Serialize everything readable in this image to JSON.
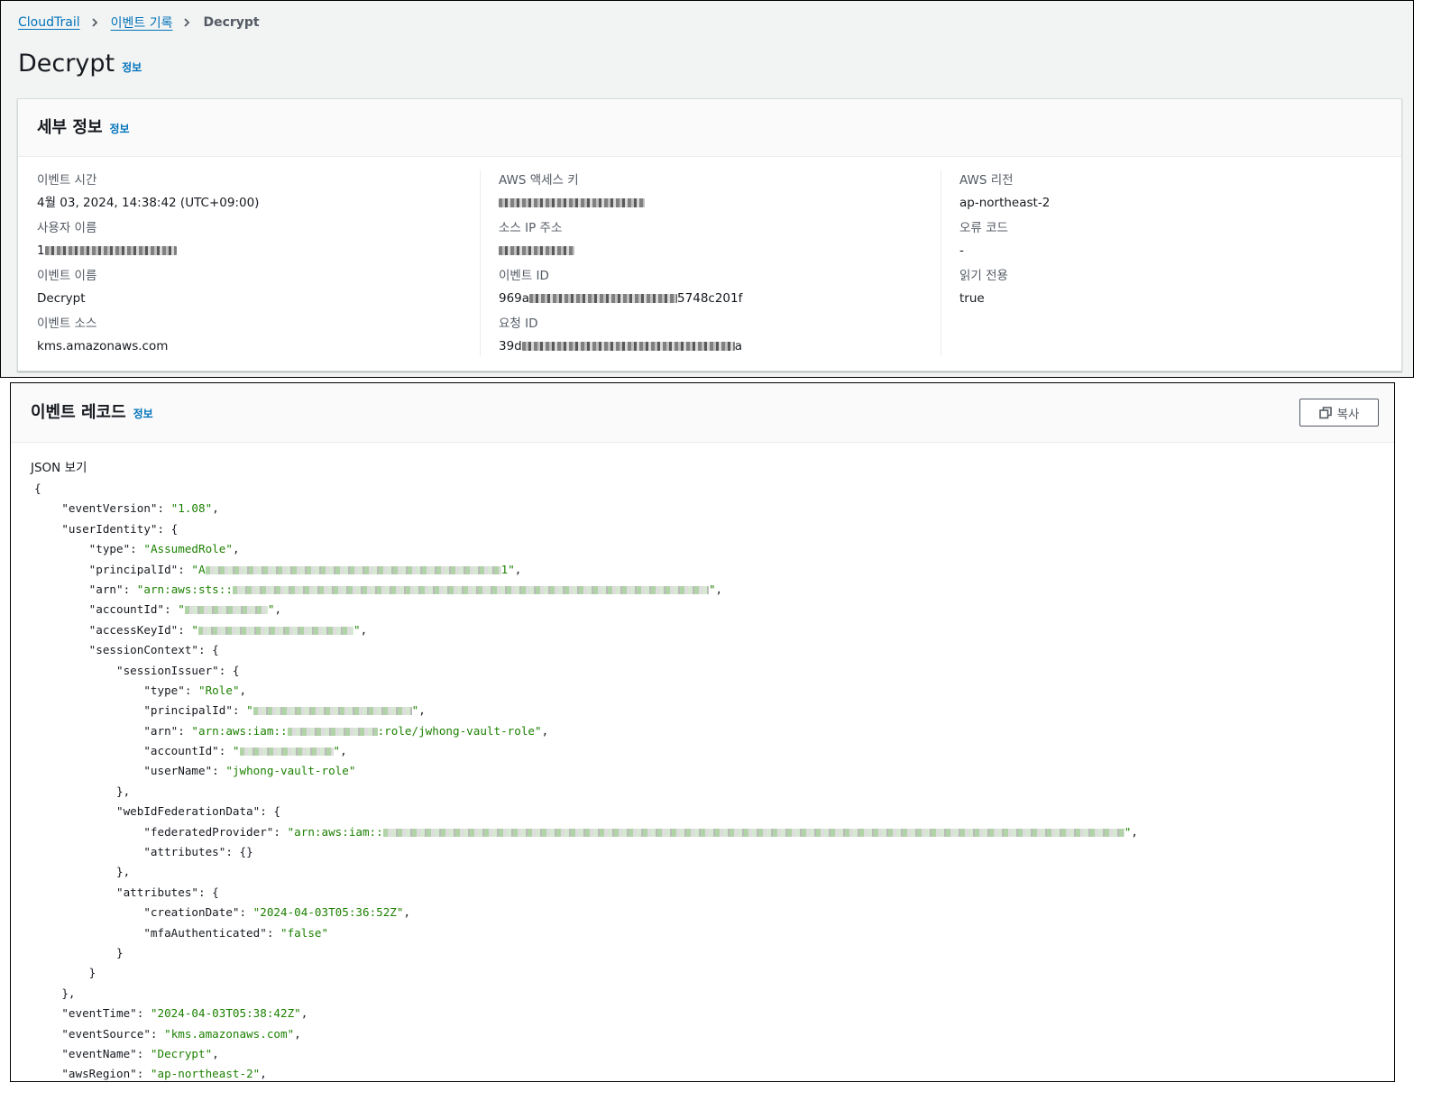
{
  "breadcrumb": {
    "items": [
      "CloudTrail",
      "이벤트 기록"
    ],
    "current": "Decrypt"
  },
  "page": {
    "title": "Decrypt",
    "info": "정보"
  },
  "details": {
    "title": "세부 정보",
    "info": "정보",
    "col1": [
      {
        "label": "이벤트 시간",
        "value": "4월 03, 2024, 14:38:42 (UTC+09:00)"
      },
      {
        "label": "사용자 이름",
        "value": "1"
      },
      {
        "label": "이벤트 이름",
        "value": "Decrypt"
      },
      {
        "label": "이벤트 소스",
        "value": "kms.amazonaws.com"
      }
    ],
    "col2": [
      {
        "label": "AWS 액세스 키",
        "value": ""
      },
      {
        "label": "소스 IP 주소",
        "value": ""
      },
      {
        "label": "이벤트 ID",
        "prefix": "969a",
        "suffix": "5748c201f"
      },
      {
        "label": "요청 ID",
        "prefix": "39d",
        "suffix": "a"
      }
    ],
    "col3": [
      {
        "label": "AWS 리전",
        "value": "ap-northeast-2"
      },
      {
        "label": "오류 코드",
        "value": "-"
      },
      {
        "label": "읽기 전용",
        "value": "true"
      }
    ]
  },
  "record": {
    "title": "이벤트 레코드",
    "info": "정보",
    "copy_label": "복사",
    "json_label": "JSON 보기",
    "json": {
      "eventVersion": "1.08",
      "type": "AssumedRole",
      "principalId_prefix": "A",
      "principalId_suffix": "1",
      "arn_prefix": "arn:aws:sts::",
      "issuer_type": "Role",
      "issuer_arn_prefix": "arn:aws:iam::",
      "issuer_arn_suffix": ":role/jwhong-vault-role",
      "userName": "jwhong-vault-role",
      "federatedProvider_prefix": "arn:aws:iam::",
      "creationDate": "2024-04-03T05:36:52Z",
      "mfaAuthenticated": "false",
      "eventTime": "2024-04-03T05:38:42Z",
      "eventSource": "kms.amazonaws.com",
      "eventName": "Decrypt",
      "awsRegion": "ap-northeast-2"
    }
  }
}
